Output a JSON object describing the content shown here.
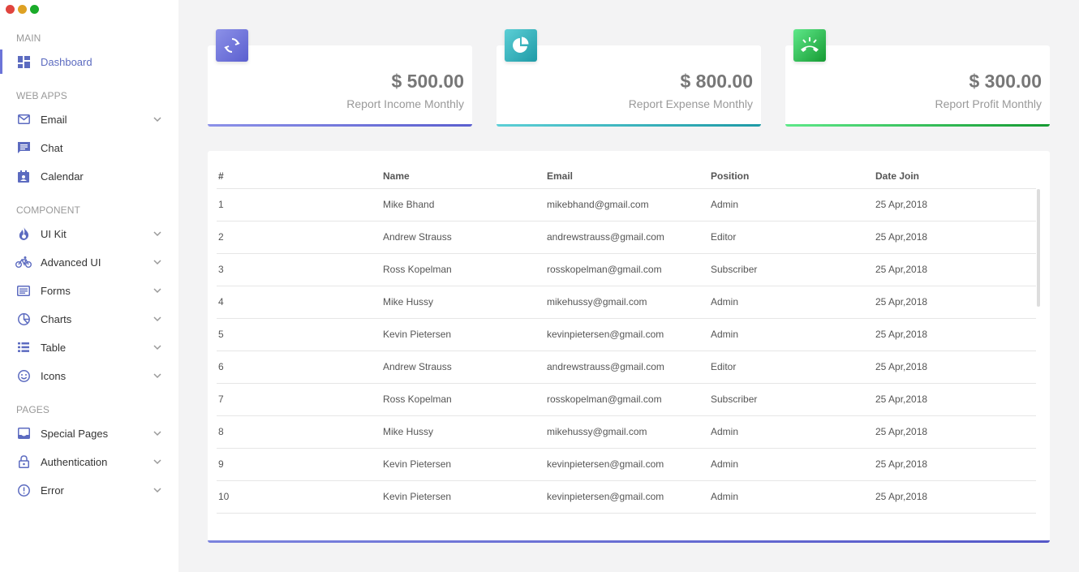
{
  "window": {
    "controls": [
      {
        "name": "close",
        "color": "#e0443e"
      },
      {
        "name": "minimize",
        "color": "#dea123"
      },
      {
        "name": "maximize",
        "color": "#1aab29"
      }
    ]
  },
  "sidebar": {
    "sections": {
      "main": "MAIN",
      "web_apps": "WEB APPS",
      "component": "COMPONENT",
      "pages": "PAGES"
    },
    "items": [
      {
        "label": "Dashboard",
        "icon": "dashboard-icon",
        "active": true
      },
      {
        "label": "Email",
        "icon": "mail-icon",
        "expandable": true
      },
      {
        "label": "Chat",
        "icon": "chat-icon"
      },
      {
        "label": "Calendar",
        "icon": "calendar-icon"
      },
      {
        "label": "UI Kit",
        "icon": "fire-icon",
        "expandable": true
      },
      {
        "label": "Advanced UI",
        "icon": "bike-icon",
        "expandable": true
      },
      {
        "label": "Forms",
        "icon": "form-icon",
        "expandable": true
      },
      {
        "label": "Charts",
        "icon": "pie-chart-icon",
        "expandable": true
      },
      {
        "label": "Table",
        "icon": "list-icon",
        "expandable": true
      },
      {
        "label": "Icons",
        "icon": "smiley-icon",
        "expandable": true
      },
      {
        "label": "Special Pages",
        "icon": "inbox-icon",
        "expandable": true
      },
      {
        "label": "Authentication",
        "icon": "lock-icon",
        "expandable": true
      },
      {
        "label": "Error",
        "icon": "alert-icon",
        "expandable": true
      }
    ],
    "accent_color": "#5c6bc0"
  },
  "stats": [
    {
      "amount": "$ 500.00",
      "caption": "Report Income Monthly",
      "icon": "refresh-icon",
      "colors": [
        "#8c91e8",
        "#5b5fcf"
      ]
    },
    {
      "amount": "$ 800.00",
      "caption": "Report Expense Monthly",
      "icon": "pie-icon",
      "colors": [
        "#5ccfd6",
        "#1e9aa6"
      ]
    },
    {
      "amount": "$ 300.00",
      "caption": "Report Profit Monthly",
      "icon": "phone-hangup-icon",
      "colors": [
        "#5ee889",
        "#159a32"
      ]
    }
  ],
  "table": {
    "headers": [
      "#",
      "Name",
      "Email",
      "Position",
      "Date Join"
    ],
    "rows": [
      [
        "1",
        "Mike Bhand",
        "mikebhand@gmail.com",
        "Admin",
        "25 Apr,2018"
      ],
      [
        "2",
        "Andrew Strauss",
        "andrewstrauss@gmail.com",
        "Editor",
        "25 Apr,2018"
      ],
      [
        "3",
        "Ross Kopelman",
        "rosskopelman@gmail.com",
        "Subscriber",
        "25 Apr,2018"
      ],
      [
        "4",
        "Mike Hussy",
        "mikehussy@gmail.com",
        "Admin",
        "25 Apr,2018"
      ],
      [
        "5",
        "Kevin Pietersen",
        "kevinpietersen@gmail.com",
        "Admin",
        "25 Apr,2018"
      ],
      [
        "6",
        "Andrew Strauss",
        "andrewstrauss@gmail.com",
        "Editor",
        "25 Apr,2018"
      ],
      [
        "7",
        "Ross Kopelman",
        "rosskopelman@gmail.com",
        "Subscriber",
        "25 Apr,2018"
      ],
      [
        "8",
        "Mike Hussy",
        "mikehussy@gmail.com",
        "Admin",
        "25 Apr,2018"
      ],
      [
        "9",
        "Kevin Pietersen",
        "kevinpietersen@gmail.com",
        "Admin",
        "25 Apr,2018"
      ],
      [
        "10",
        "Kevin Pietersen",
        "kevinpietersen@gmail.com",
        "Admin",
        "25 Apr,2018"
      ]
    ]
  }
}
